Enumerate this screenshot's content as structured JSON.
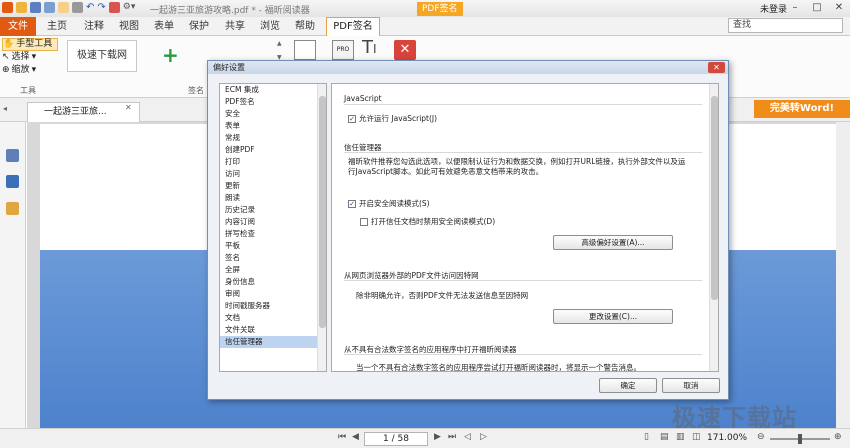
{
  "window": {
    "title": "一起游三亚旅游攻略.pdf * - 福昕阅读器",
    "context_tab": "PDF签名",
    "login": "未登录"
  },
  "ribbon_tabs": [
    "文件",
    "主页",
    "注释",
    "视图",
    "表单",
    "保护",
    "共享",
    "浏览",
    "帮助",
    "PDF签名"
  ],
  "search": {
    "placeholder": "查找"
  },
  "toolbar": {
    "hand_tool": "手型工具",
    "select": "选择",
    "zoom": "缩放",
    "group_tools": "工具",
    "group_sign": "签名",
    "signature_sample": "极速下载网"
  },
  "doc_tab": {
    "label": "一起游三亚旅..."
  },
  "convert_button": "完美转Word!",
  "status": {
    "page": "1 / 58",
    "zoom": "171.00%"
  },
  "watermark": "极速下载站",
  "dialog": {
    "title": "偏好设置",
    "categories": [
      "ECM 集成",
      "PDF签名",
      "安全",
      "表单",
      "常规",
      "创建PDF",
      "打印",
      "访问",
      "更新",
      "朗读",
      "历史记录",
      "内容订阅",
      "拼写检查",
      "平板",
      "签名",
      "全屏",
      "身份信息",
      "审阅",
      "时间戳服务器",
      "文档",
      "文件关联",
      "信任管理器"
    ],
    "selected_category": "信任管理器",
    "js_group": "JavaScript",
    "js_enable": "允许运行 JavaScript(J)",
    "trust_group": "信任管理器",
    "trust_desc_1": "福昕软件推荐您勾选此选项，以便限制认证行为和数据交换，例如打开URL链接，执行外部文件以及运",
    "trust_desc_2": "行JavaScript脚本。如此可有效避免恶意文档带来的攻击。",
    "safe_mode": "开启安全阅读模式(S)",
    "trust_doc": "打开信任文档时禁用安全阅读模式(D)",
    "advanced_btn": "高级偏好设置(A)...",
    "url_group": "从网页浏览器外部的PDF文件访问因特网",
    "url_desc": "除非明确允许，否则PDF文件无法发送信息至因特网",
    "change_btn": "更改设置(C)...",
    "cert_group": "从不具有合法数字签名的应用程序中打开福昕阅读器",
    "cert_desc": "当一个不具有合法数字签名的应用程序尝试打开福昕阅读器时，将显示一个警告消息。",
    "ok": "确定",
    "cancel": "取消"
  }
}
